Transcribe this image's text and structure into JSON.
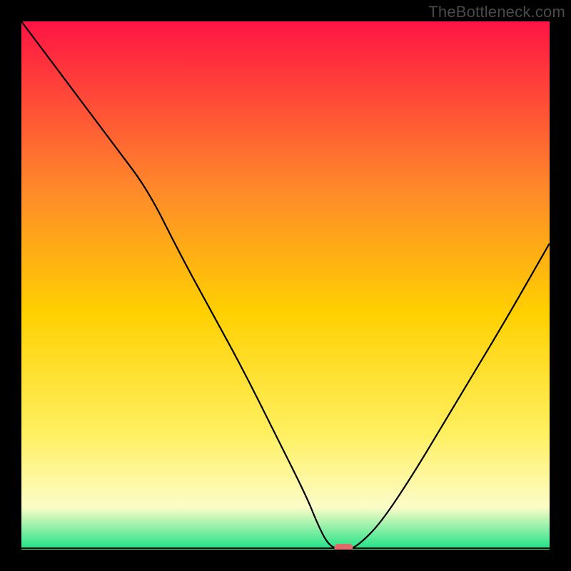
{
  "watermark": "TheBottleneck.com",
  "colors": {
    "top": "#ff1444",
    "upper_mid": "#ff8a2a",
    "mid": "#ffd000",
    "lower_mid": "#fff060",
    "pale": "#fcfcc8",
    "green": "#1de385",
    "background": "#000000",
    "curve": "#000000",
    "marker": "#e06a6a"
  },
  "chart_data": {
    "type": "line",
    "title": "",
    "xlabel": "",
    "ylabel": "",
    "xlim": [
      0,
      100
    ],
    "ylim": [
      0,
      100
    ],
    "x": [
      0,
      6,
      12,
      18,
      24,
      30,
      36,
      42,
      48,
      54,
      56,
      58,
      60,
      62,
      64,
      68,
      74,
      80,
      86,
      92,
      100
    ],
    "values": [
      100,
      92,
      84,
      76,
      68,
      56,
      45,
      34,
      22,
      10,
      5,
      1,
      0,
      0,
      1,
      5,
      14,
      24,
      34,
      44,
      58
    ],
    "marker": {
      "x": 61,
      "y": 0
    },
    "plateau_x_range": [
      58,
      63
    ],
    "notes": "V-shaped bottleneck curve on vertical red-to-green gradient; minimum (optimal point) near x≈61 at y=0 with small flat plateau; right limb rises more gently than left limb."
  }
}
